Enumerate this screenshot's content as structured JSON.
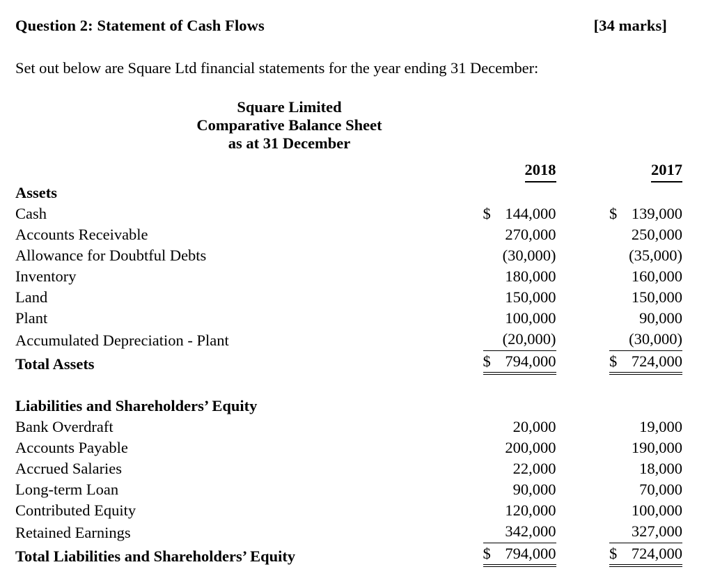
{
  "header": {
    "question_title": "Question 2: Statement of Cash Flows",
    "marks": "[34 marks]"
  },
  "intro": "Set out below are Square Ltd financial statements for the year ending 31 December:",
  "statement_heading": {
    "line1": "Square Limited",
    "line2": "Comparative Balance Sheet",
    "line3": "as at 31 December"
  },
  "columns": {
    "label": "",
    "year_current": "2018",
    "year_prior": "2017"
  },
  "sections": [
    {
      "heading": "Assets",
      "rows": [
        {
          "label": "Cash",
          "currency_2018": "$",
          "v2018": "144,000",
          "currency_2017": "$",
          "v2017": "139,000"
        },
        {
          "label": "Accounts Receivable",
          "currency_2018": "",
          "v2018": "270,000",
          "currency_2017": "",
          "v2017": "250,000"
        },
        {
          "label": "Allowance for Doubtful Debts",
          "currency_2018": "",
          "v2018": "(30,000)",
          "currency_2017": "",
          "v2017": "(35,000)"
        },
        {
          "label": "Inventory",
          "currency_2018": "",
          "v2018": "180,000",
          "currency_2017": "",
          "v2017": "160,000"
        },
        {
          "label": "Land",
          "currency_2018": "",
          "v2018": "150,000",
          "currency_2017": "",
          "v2017": "150,000"
        },
        {
          "label": "Plant",
          "currency_2018": "",
          "v2018": "100,000",
          "currency_2017": "",
          "v2017": "90,000"
        },
        {
          "label": "Accumulated Depreciation - Plant",
          "currency_2018": "",
          "v2018": "(20,000)",
          "currency_2017": "",
          "v2017": "(30,000)",
          "rule": "single"
        }
      ],
      "total": {
        "label": "Total Assets",
        "currency_2018": "$",
        "v2018": "794,000",
        "currency_2017": "$",
        "v2017": "724,000",
        "rule": "double"
      }
    },
    {
      "heading": "Liabilities and Shareholders’ Equity",
      "rows": [
        {
          "label": "Bank Overdraft",
          "currency_2018": "",
          "v2018": "20,000",
          "currency_2017": "",
          "v2017": "19,000"
        },
        {
          "label": "Accounts Payable",
          "currency_2018": "",
          "v2018": "200,000",
          "currency_2017": "",
          "v2017": "190,000"
        },
        {
          "label": "Accrued Salaries",
          "currency_2018": "",
          "v2018": "22,000",
          "currency_2017": "",
          "v2017": "18,000"
        },
        {
          "label": "Long-term Loan",
          "currency_2018": "",
          "v2018": "90,000",
          "currency_2017": "",
          "v2017": "70,000"
        },
        {
          "label": "Contributed Equity",
          "currency_2018": "",
          "v2018": "120,000",
          "currency_2017": "",
          "v2017": "100,000"
        },
        {
          "label": "Retained Earnings",
          "currency_2018": "",
          "v2018": "342,000",
          "currency_2017": "",
          "v2017": "327,000",
          "rule": "single"
        }
      ],
      "total": {
        "label": "Total Liabilities and Shareholders’ Equity",
        "currency_2018": "$",
        "v2018": "794,000",
        "currency_2017": "$",
        "v2017": "724,000",
        "rule": "double"
      }
    }
  ],
  "colors": {
    "text": "#000000",
    "background": "#ffffff"
  }
}
